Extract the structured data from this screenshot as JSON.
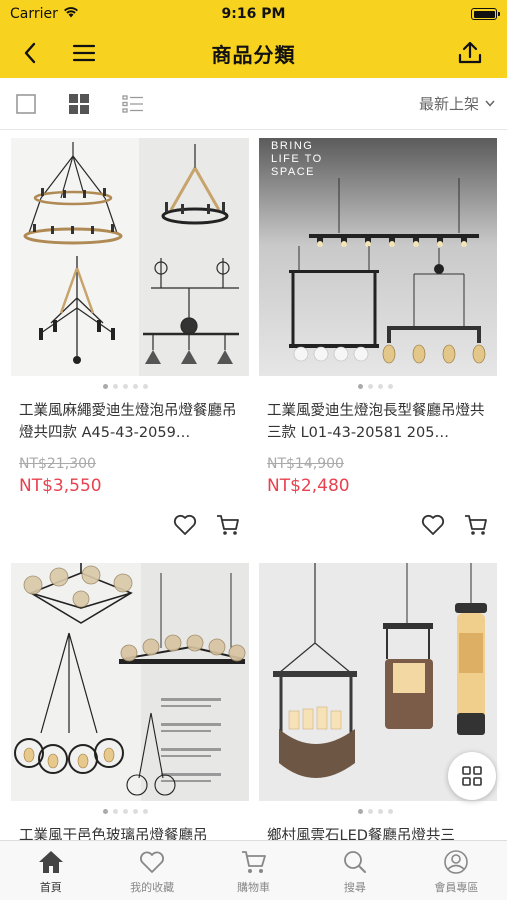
{
  "status_bar": {
    "carrier": "Carrier",
    "time": "9:16 PM"
  },
  "nav": {
    "title": "商品分類"
  },
  "filter": {
    "sort_label": "最新上架"
  },
  "products": [
    {
      "name": "工業風麻繩愛迪生燈泡吊燈餐廳吊燈共四款 A45-43-2059…",
      "old_price": "NT$21,300",
      "price": "NT$3,550"
    },
    {
      "name": "工業風愛迪生燈泡長型餐廳吊燈共三款 L01-43-20581 205…",
      "old_price": "NT$14,900",
      "price": "NT$2,480",
      "image_text": [
        "BRING",
        "LIFE TO",
        "SPACE"
      ]
    },
    {
      "name": "工業風干邑色玻璃吊燈餐廳吊",
      "old_price": "",
      "price": ""
    },
    {
      "name": "鄉村風雲石LED餐廳吊燈共三",
      "old_price": "",
      "price": ""
    }
  ],
  "tabs": [
    {
      "label": "首頁"
    },
    {
      "label": "我的收藏"
    },
    {
      "label": "購物車"
    },
    {
      "label": "搜尋"
    },
    {
      "label": "會員專區"
    }
  ],
  "colors": {
    "accent": "#f7d21e",
    "price": "#e8414f"
  }
}
